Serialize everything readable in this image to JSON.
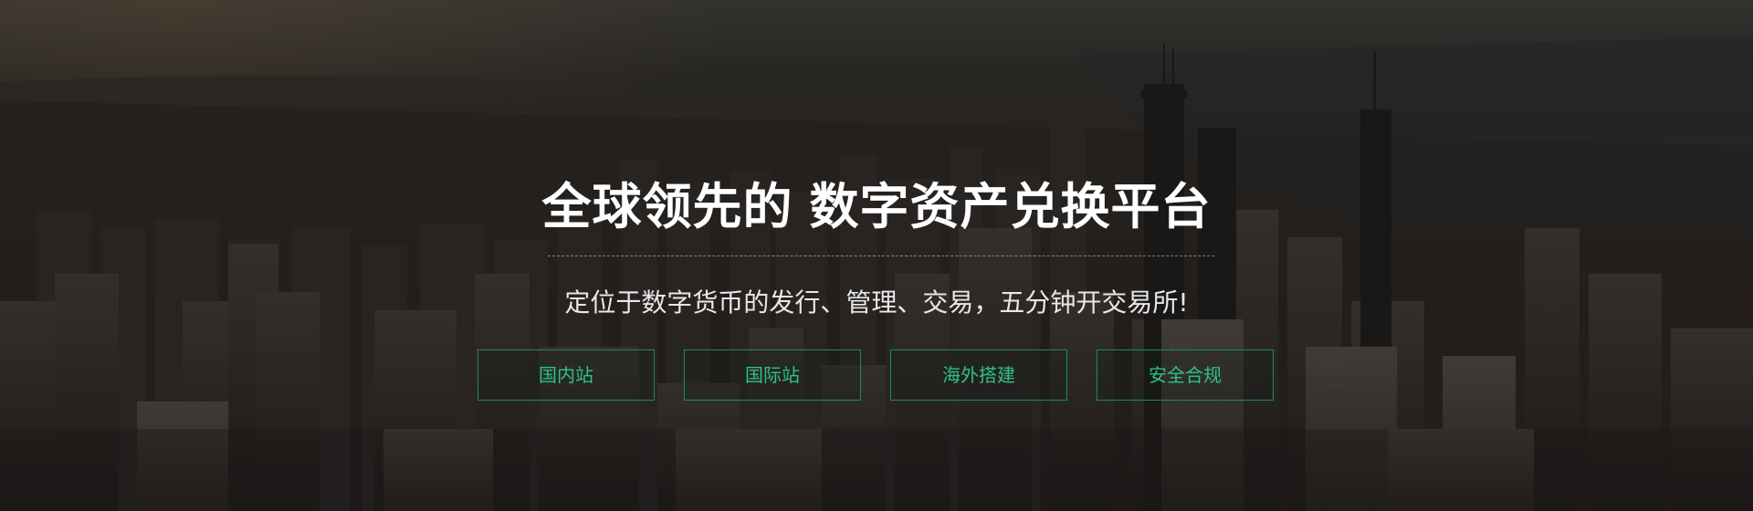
{
  "hero": {
    "title_part1": "全球领先的",
    "title_part2": "数字资产兑换平台",
    "subtitle": "定位于数字货币的发行、管理、交易，五分钟开交易所!"
  },
  "buttons": [
    {
      "label": "国内站"
    },
    {
      "label": "国际站"
    },
    {
      "label": "海外搭建"
    },
    {
      "label": "安全合规"
    }
  ],
  "colors": {
    "accent": "#2ec285",
    "button_border": "#1e8a5e",
    "title": "#ffffff",
    "subtitle": "#e8e8e8"
  }
}
